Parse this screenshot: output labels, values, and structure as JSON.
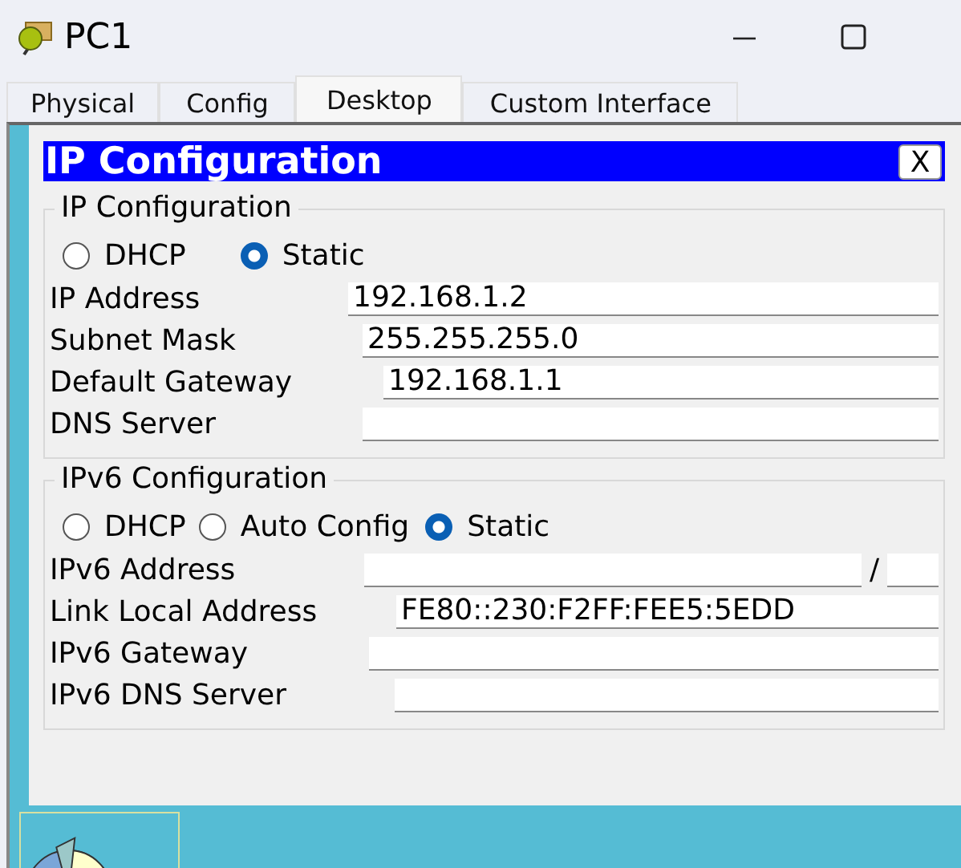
{
  "window": {
    "title": "PC1"
  },
  "tabs": [
    {
      "label": "Physical",
      "selected": false
    },
    {
      "label": "Config",
      "selected": false
    },
    {
      "label": "Desktop",
      "selected": true
    },
    {
      "label": "Custom Interface",
      "selected": false
    }
  ],
  "dialog": {
    "title": "IP Configuration",
    "close": "X",
    "groups": [
      {
        "legend": "IP Configuration",
        "modes": [
          {
            "label": "DHCP",
            "selected": false
          },
          {
            "label": "Static",
            "selected": true
          }
        ],
        "fields": [
          {
            "label": "IP Address",
            "value": "192.168.1.2",
            "kind": "plain"
          },
          {
            "label": "Subnet Mask",
            "value": "255.255.255.0",
            "kind": "plain"
          },
          {
            "label": "Default Gateway",
            "value": "192.168.1.1",
            "kind": "plain"
          },
          {
            "label": "DNS Server",
            "kind": "plain"
          }
        ]
      },
      {
        "legend": "IPv6 Configuration",
        "modes": [
          {
            "label": "DHCP",
            "selected": false
          },
          {
            "label": "Auto Config",
            "selected": false
          },
          {
            "label": "Static",
            "selected": true
          }
        ],
        "fields": [
          {
            "label": "IPv6 Address",
            "kind": "prefix",
            "separator": "/"
          },
          {
            "label": "Link Local Address",
            "value": "FE80::230:F2FF:FEE5:5EDD",
            "kind": "plain"
          },
          {
            "label": "IPv6 Gateway",
            "kind": "plain"
          },
          {
            "label": "IPv6 DNS Server",
            "kind": "plain"
          }
        ]
      }
    ]
  }
}
